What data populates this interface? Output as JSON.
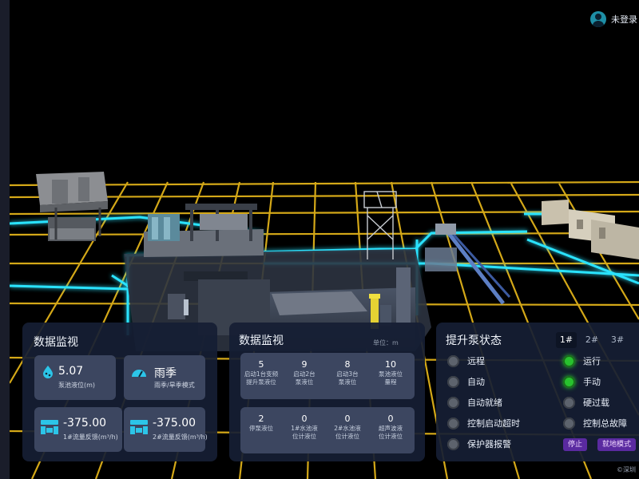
{
  "user": {
    "label": "未登录"
  },
  "panel1": {
    "title": "数据监视",
    "level": {
      "value": "5.07",
      "label": "泵池液位(m)"
    },
    "season": {
      "value": "雨季",
      "label": "雨季/旱季模式"
    },
    "flow1": {
      "value": "-375.00",
      "label": "1#流量反馈(m³/h)"
    },
    "flow2": {
      "value": "-375.00",
      "label": "2#流量反馈(m³/h)"
    }
  },
  "panel2": {
    "title": "数据监视",
    "unit": "单位：m",
    "row1": [
      {
        "value": "5",
        "label1": "启动1台变频",
        "label2": "提升泵液位"
      },
      {
        "value": "9",
        "label1": "启动2台",
        "label2": "泵液位"
      },
      {
        "value": "8",
        "label1": "启动3台",
        "label2": "泵液位"
      },
      {
        "value": "10",
        "label1": "泵池液位",
        "label2": "量程"
      }
    ],
    "row2": [
      {
        "value": "2",
        "label1": "停泵液位",
        "label2": ""
      },
      {
        "value": "0",
        "label1": "1#水池液",
        "label2": "位计液位"
      },
      {
        "value": "0",
        "label1": "2#水池液",
        "label2": "位计液位"
      },
      {
        "value": "0",
        "label1": "超声波液",
        "label2": "位计液位"
      }
    ]
  },
  "panel3": {
    "title": "提升泵状态",
    "tabs": [
      "1#",
      "2#",
      "3#"
    ],
    "active_tab": "1#",
    "left_items": [
      {
        "label": "远程",
        "on": false
      },
      {
        "label": "自动",
        "on": false
      },
      {
        "label": "自动就绪",
        "on": false
      },
      {
        "label": "控制启动超时",
        "on": false
      },
      {
        "label": "保护器报警",
        "on": false
      }
    ],
    "right_items": [
      {
        "label": "运行",
        "on": true
      },
      {
        "label": "手动",
        "on": true
      },
      {
        "label": "硬过载",
        "on": false
      },
      {
        "label": "控制总故障",
        "on": false
      }
    ],
    "btn_stop": "停止",
    "btn_mode": "就地模式"
  },
  "watermark": "©深圳",
  "colors": {
    "grid": "#e0b21a",
    "glow": "#29e3ff",
    "panel": "#161e34",
    "card": "#3c4660",
    "status_on": "#28c12e",
    "status_off": "#5d636d",
    "accent_button": "#5a2aa0"
  }
}
